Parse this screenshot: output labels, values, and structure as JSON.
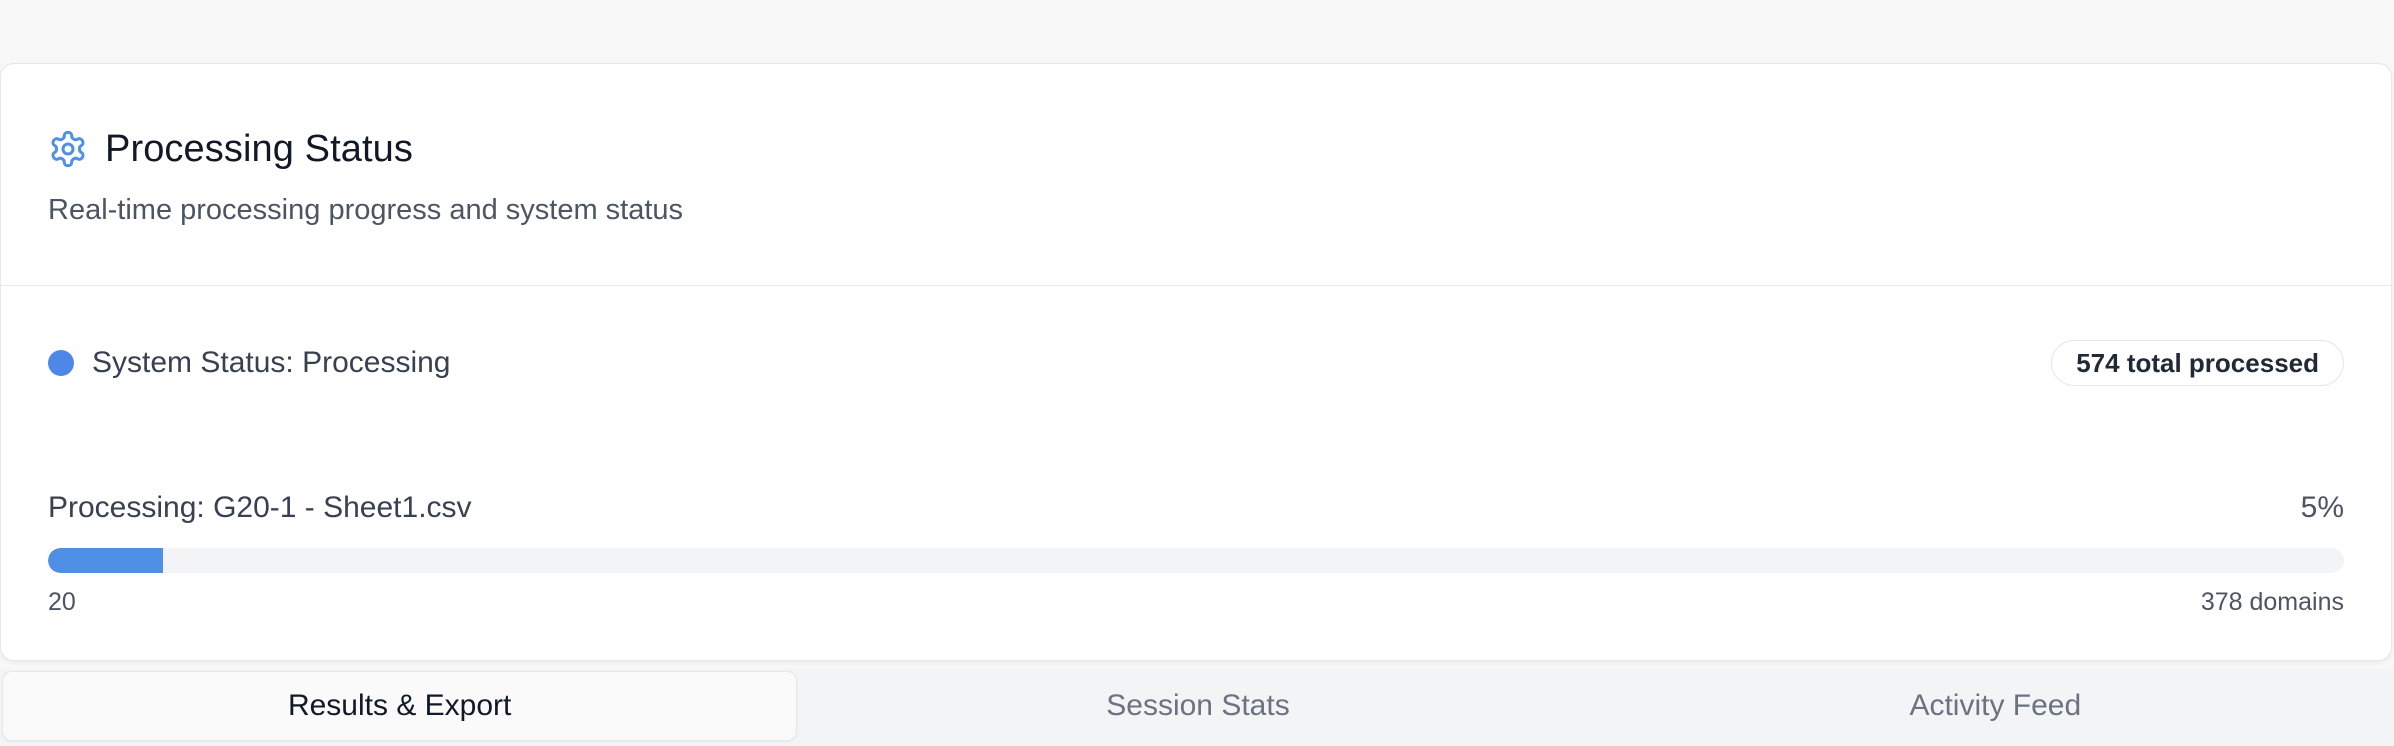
{
  "panel": {
    "title": "Processing Status",
    "subtitle": "Real-time processing progress and system status",
    "title_icon": "gear-icon",
    "accent_color": "#4f8fe6"
  },
  "status": {
    "label": "System Status: Processing",
    "indicator_color": "#4f87e8",
    "total_badge": "574 total processed"
  },
  "progress": {
    "file_label": "Processing: G20-1 - Sheet1.csv",
    "percent_label": "5%",
    "percent_value": 5,
    "current_count": "20",
    "total_label": "378 domains"
  },
  "tabs": [
    {
      "label": "Results & Export",
      "active": true
    },
    {
      "label": "Session Stats",
      "active": false
    },
    {
      "label": "Activity Feed",
      "active": false
    }
  ]
}
